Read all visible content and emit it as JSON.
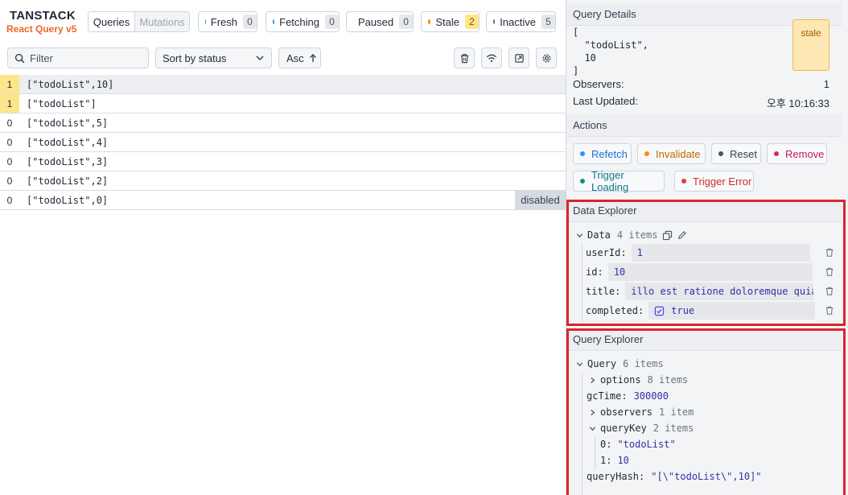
{
  "brand": {
    "title": "TANSTACK",
    "subtitle": "React Query v5"
  },
  "mode_tabs": {
    "queries": "Queries",
    "mutations": "Mutations"
  },
  "status_filters": [
    {
      "label": "Fresh",
      "count": "0",
      "color": "#12b76a"
    },
    {
      "label": "Fetching",
      "count": "0",
      "color": "#2e90fa"
    },
    {
      "label": "Paused",
      "count": "0",
      "color": "#7a5af8"
    },
    {
      "label": "Stale",
      "count": "2",
      "color": "#f79009"
    },
    {
      "label": "Inactive",
      "count": "5",
      "color": "#667085"
    }
  ],
  "toolbar": {
    "filter_placeholder": "Filter",
    "sort_value": "Sort by status",
    "order_label": "Asc",
    "icons": [
      "trash-icon",
      "wifi-icon",
      "popout-icon",
      "settings-icon"
    ]
  },
  "queries": [
    {
      "observers": "1",
      "key": "[\"todoList\",10]",
      "badge": ""
    },
    {
      "observers": "1",
      "key": "[\"todoList\"]",
      "badge": ""
    },
    {
      "observers": "0",
      "key": "[\"todoList\",5]",
      "badge": ""
    },
    {
      "observers": "0",
      "key": "[\"todoList\",4]",
      "badge": ""
    },
    {
      "observers": "0",
      "key": "[\"todoList\",3]",
      "badge": ""
    },
    {
      "observers": "0",
      "key": "[\"todoList\",2]",
      "badge": ""
    },
    {
      "observers": "0",
      "key": "[\"todoList\",0]",
      "badge": "disabled"
    }
  ],
  "details": {
    "header": "Query Details",
    "key_text": "[\n  \"todoList\",\n  10\n]",
    "status": "stale",
    "observers_label": "Observers:",
    "observers_value": "1",
    "updated_label": "Last Updated:",
    "updated_value": "오후 10:16:33"
  },
  "actions": {
    "header": "Actions",
    "buttons": [
      {
        "label": "Refetch",
        "color": "#2e90fa",
        "text_color": "#1d6fd6"
      },
      {
        "label": "Invalidate",
        "color": "#f79009",
        "text_color": "#c26a00"
      },
      {
        "label": "Reset",
        "color": "#475467",
        "text_color": "#374151"
      },
      {
        "label": "Remove",
        "color": "#e0245e",
        "text_color": "#c2185b"
      },
      {
        "label": "Trigger Loading",
        "color": "#0e9384",
        "text_color": "#0b7a87"
      },
      {
        "label": "Trigger Error",
        "color": "#e23c3c",
        "text_color": "#d12c2c"
      }
    ]
  },
  "data_explorer": {
    "header": "Data Explorer",
    "root_label": "Data",
    "root_count": "4 items",
    "fields": [
      {
        "key": "userId:",
        "value": "1"
      },
      {
        "key": "id:",
        "value": "10"
      },
      {
        "key": "title:",
        "value": "illo est ratione doloremque quia m"
      },
      {
        "key": "completed:",
        "value": "true"
      }
    ]
  },
  "query_explorer": {
    "header": "Query Explorer",
    "root_label": "Query",
    "root_count": "6 items",
    "options_label": "options",
    "options_count": "8 items",
    "gc_label": "gcTime:",
    "gc_value": "300000",
    "observers_label": "observers",
    "observers_count": "1 item",
    "querykey_label": "queryKey",
    "querykey_count": "2 items",
    "key0_label": "0:",
    "key0_value": "\"todoList\"",
    "key1_label": "1:",
    "key1_value": "10",
    "hash_label": "queryHash:",
    "hash_value": "\"[\\\"todoList\\\",10]\""
  },
  "colors": {
    "highlight": "#d9262c",
    "stale_bg": "#fde7b2",
    "warning_observer": "#fde68a"
  }
}
